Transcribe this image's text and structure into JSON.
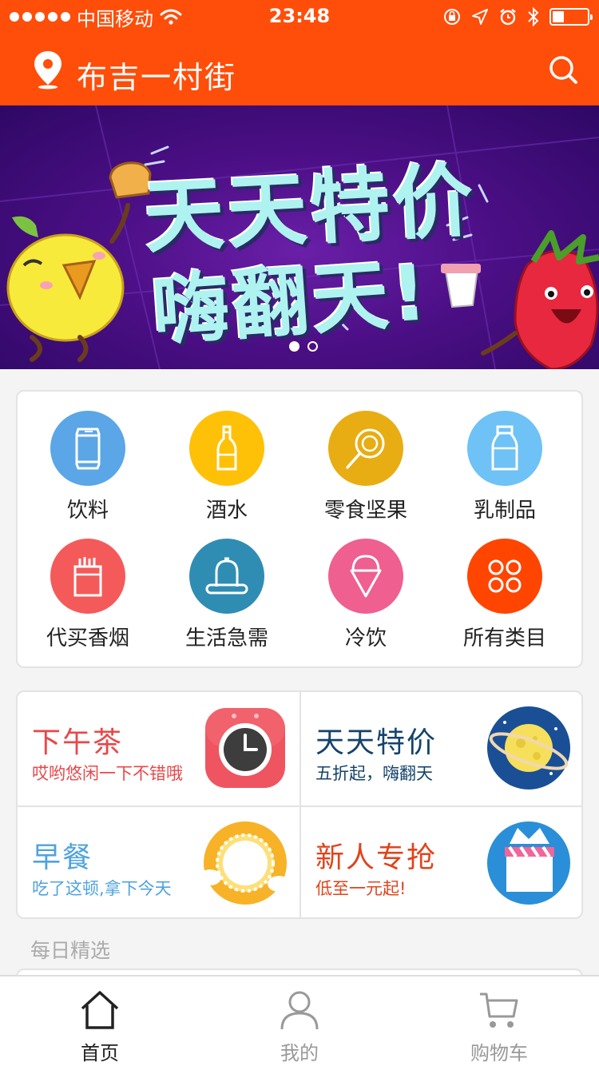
{
  "status_bar": {
    "carrier": "中国移动",
    "time": "23:48"
  },
  "header": {
    "location": "布吉一村街",
    "location_icon": "map-pin-icon",
    "search_icon": "search-icon"
  },
  "banner": {
    "line1": "天天特价",
    "line2": "嗨翻天!",
    "current_page": 1,
    "total_pages": 2
  },
  "categories": [
    {
      "label": "饮料",
      "icon": "can-icon",
      "color": "#5aa6e6"
    },
    {
      "label": "酒水",
      "icon": "bottle-icon",
      "color": "#ffc107"
    },
    {
      "label": "零食坚果",
      "icon": "lollipop-icon",
      "color": "#e8ad12"
    },
    {
      "label": "乳制品",
      "icon": "milk-bottle-icon",
      "color": "#6ec2f5"
    },
    {
      "label": "代买香烟",
      "icon": "cigarette-pack-icon",
      "color": "#f55a5a"
    },
    {
      "label": "生活急需",
      "icon": "condom-icon",
      "color": "#2f8db3"
    },
    {
      "label": "冷饮",
      "icon": "ice-cream-icon",
      "color": "#ef5f8f"
    },
    {
      "label": "所有类目",
      "icon": "grid-circles-icon",
      "color": "#ff4500"
    }
  ],
  "promos": [
    {
      "title": "下午茶",
      "subtitle": "哎哟悠闲一下不错哦",
      "icon": "clock-app-icon",
      "color": "#e8484a"
    },
    {
      "title": "天天特价",
      "subtitle": "五折起，嗨翻天",
      "icon": "moon-planet-icon",
      "color": "#14436b"
    },
    {
      "title": "早餐",
      "subtitle": "吃了这顿,拿下今天",
      "icon": "sun-icon",
      "color": "#4fa3dc"
    },
    {
      "title": "新人专抢",
      "subtitle": "低至一元起!",
      "icon": "clapperboard-icon",
      "color": "#e0441c"
    }
  ],
  "section": {
    "daily_title": "每日精选"
  },
  "tabbar": [
    {
      "label": "首页",
      "icon": "home-icon",
      "active": true
    },
    {
      "label": "我的",
      "icon": "user-icon",
      "active": false
    },
    {
      "label": "购物车",
      "icon": "cart-icon",
      "active": false
    }
  ]
}
